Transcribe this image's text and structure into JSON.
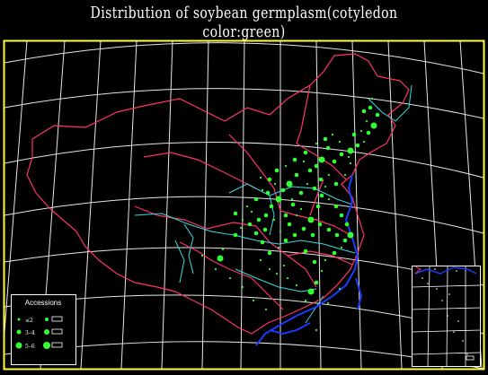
{
  "title": "Distribution of soybean germplasm(cotyledon color:green)",
  "legend": {
    "title": "Accessions",
    "entries": [
      {
        "label": "≤2"
      },
      {
        "label": "3–4"
      },
      {
        "label": "5–6"
      },
      {
        "label": ""
      },
      {
        "label": ""
      },
      {
        "label": ""
      }
    ]
  },
  "colors": {
    "background": "#000000",
    "frame": "#ffff33",
    "graticule": "#ffffff",
    "national_border": "#ff3366",
    "provincial_border": "#ff3366",
    "rivers": "#33dddd",
    "coast": "#1a3cff",
    "points": "#33ff33"
  },
  "icons": [
    "graticule",
    "border-lines",
    "river-lines",
    "coastline",
    "accession-dots",
    "south-china-sea-inset"
  ]
}
